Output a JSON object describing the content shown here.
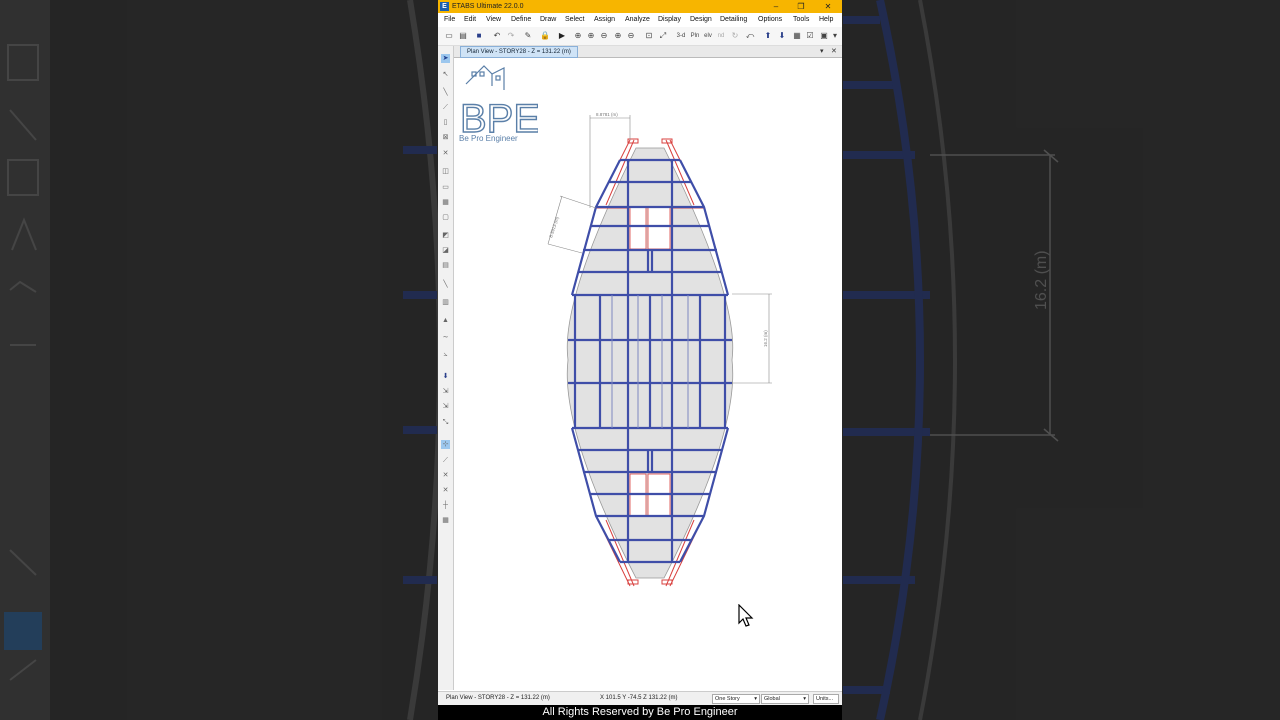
{
  "window": {
    "title": "ETABS Ultimate 22.0.0",
    "icon_label": "E",
    "buttons": [
      "–",
      "❐",
      "✕"
    ]
  },
  "menu": [
    "File",
    "Edit",
    "View",
    "Define",
    "Draw",
    "Select",
    "Assign",
    "Analyze",
    "Display",
    "Design",
    "Detailing",
    "Options",
    "Tools",
    "Help"
  ],
  "toolbar": {
    "view_3d_label": "3-d",
    "plan_label": "Pln",
    "elev_label": "elv",
    "nd_label": "nd"
  },
  "view_tab": {
    "label": "Plan View - STORY28 - Z = 131.22 (m)"
  },
  "drawing": {
    "dim_top": "8.8781 (m)",
    "dim_left": "8.3913 (m)",
    "dim_right": "16.2 (m)",
    "bg_dim": "16.2 (m)"
  },
  "logo": {
    "letters": "BPE",
    "text": "Be Pro Engineer"
  },
  "status": {
    "view": "Plan View - STORY28 - Z = 131.22 (m)",
    "coords": "X 101.5  Y -74.5  Z 131.22 (m)",
    "story_select": "One Story",
    "coord_system": "Global",
    "units_button": "Units..."
  },
  "footer": {
    "text": "All Rights Reserved by Be Pro Engineer"
  },
  "colors": {
    "beam": "#3f4ea8",
    "brace": "#d9413f",
    "slab": "#e2e2e2",
    "title_bar": "#f7b500"
  }
}
